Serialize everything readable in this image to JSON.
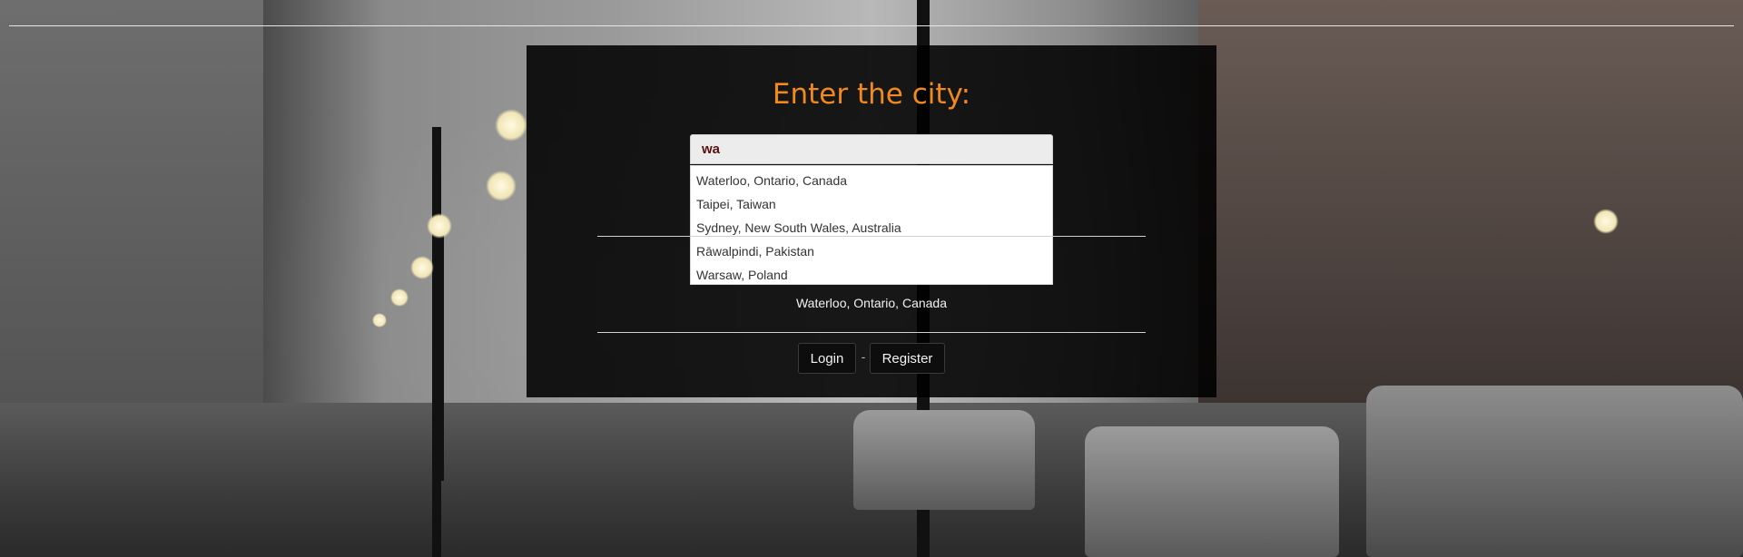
{
  "page": {
    "heading": "Enter the city:"
  },
  "search": {
    "value": "wa",
    "suggestions": [
      "Waterloo, Ontario, Canada",
      "Taipei, Taiwan",
      "Sydney, New South Wales, Australia",
      "Rāwalpindi, Pakistan",
      "Warsaw, Poland"
    ]
  },
  "result": {
    "selected_city": "Waterloo, Ontario, Canada"
  },
  "auth": {
    "login_label": "Login",
    "separator": "-",
    "register_label": "Register"
  },
  "colors": {
    "heading": "#f0891e",
    "panel": "#000000",
    "input_text": "#5a1010"
  }
}
